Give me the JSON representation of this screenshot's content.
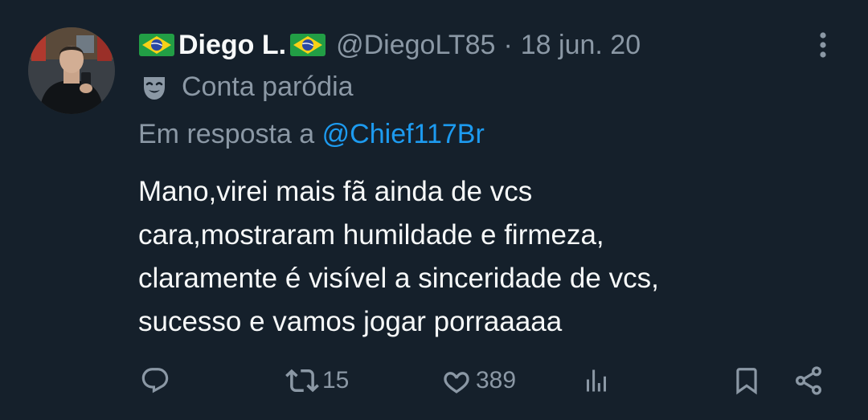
{
  "tweet": {
    "author": {
      "display_name": "Diego L.",
      "handle": "@DiegoLT85",
      "flag_icon": "brazil-flag-icon",
      "label_icon": "theater-mask-icon",
      "label": "Conta paródia"
    },
    "separator": "·",
    "date": "18 jun. 20",
    "reply_prefix": "Em resposta a",
    "reply_to": "@Chief117Br",
    "text_lines": [
      "Mano,virei mais fã ainda de vcs",
      "cara,mostraram humildade e firmeza,",
      "claramente é visível a sinceridade de vcs,",
      "sucesso e vamos jogar porraaaaa"
    ],
    "stats": {
      "replies": "",
      "retweets": "15",
      "likes": "389"
    }
  },
  "icons": {
    "more": "more-vertical-icon",
    "reply": "reply-icon",
    "retweet": "retweet-icon",
    "like": "heart-icon",
    "views": "bar-chart-icon",
    "bookmark": "bookmark-icon",
    "share": "share-icon"
  },
  "colors": {
    "background": "#15202b",
    "primary_text": "#f7f9f9",
    "secondary_text": "#8b98a5",
    "link": "#1d9bf0"
  }
}
